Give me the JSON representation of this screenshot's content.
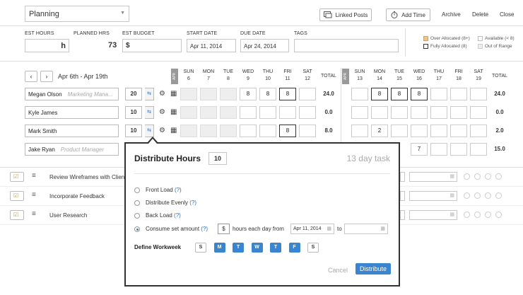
{
  "project": {
    "name": "Planning",
    "buttons": {
      "linked_posts": "Linked Posts",
      "add_time": "Add Time",
      "archive": "Archive",
      "delete": "Delete",
      "close": "Close"
    }
  },
  "fields": {
    "est_hours_label": "EST HOURS",
    "est_hours_value": "h",
    "planned_hrs_label": "PLANNED HRS",
    "planned_hrs_value": "73",
    "est_budget_label": "EST BUDGET",
    "est_budget_value": "$",
    "start_date_label": "START DATE",
    "start_date_value": "Apr 11, 2014",
    "due_date_label": "DUE DATE",
    "due_date_value": "Apr 24, 2014",
    "tags_label": "TAGS",
    "tags_value": ""
  },
  "legend": {
    "over": "Over Allocated (8+)",
    "available": "Available (< 8)",
    "fully": "Fully Allocated (8)",
    "out_of_range": "Out of Range",
    "colors": {
      "over": "#f5c37a",
      "fully": "#ffffff",
      "available": "#ffffff",
      "out_of_range": "#eeeeee"
    }
  },
  "calendar": {
    "range": "Apr 6th - Apr 19th",
    "month_tag": "APR",
    "total_label": "TOTAL",
    "week1": [
      {
        "day": "SUNDAY",
        "abbr": "SUN",
        "date": "6"
      },
      {
        "day": "MONDAY",
        "abbr": "MON",
        "date": "7"
      },
      {
        "day": "TUESDAY",
        "abbr": "TUE",
        "date": "8"
      },
      {
        "day": "WEDNESDAY",
        "abbr": "WED",
        "date": "9"
      },
      {
        "day": "THURSDAY",
        "abbr": "THU",
        "date": "10"
      },
      {
        "day": "FRIDAY",
        "abbr": "FRI",
        "date": "11"
      },
      {
        "day": "SATURDAY",
        "abbr": "SAT",
        "date": "12"
      }
    ],
    "week2": [
      {
        "abbr": "SUN",
        "date": "13"
      },
      {
        "abbr": "MON",
        "date": "14"
      },
      {
        "abbr": "TUE",
        "date": "15"
      },
      {
        "abbr": "WED",
        "date": "16"
      },
      {
        "abbr": "THU",
        "date": "17"
      },
      {
        "abbr": "FRI",
        "date": "18"
      },
      {
        "abbr": "SAT",
        "date": "19"
      }
    ]
  },
  "people": [
    {
      "name": "Megan Olson",
      "role": "Marketing Mana...",
      "hours": "20",
      "w1": [
        "",
        "",
        "",
        "8",
        "8",
        "8",
        ""
      ],
      "t1": "24.0",
      "w2": [
        "",
        "8",
        "8",
        "8",
        "",
        "",
        ""
      ],
      "t2": "24.0"
    },
    {
      "name": "Kyle James",
      "role": "",
      "hours": "10",
      "w1": [
        "",
        "",
        "",
        "",
        "",
        "",
        ""
      ],
      "t1": "0.0",
      "w2": [
        "",
        "",
        "",
        "",
        "",
        "",
        ""
      ],
      "t2": "0.0"
    },
    {
      "name": "Mark Smith",
      "role": "",
      "hours": "10",
      "w1": [
        "",
        "",
        "",
        "",
        "",
        "8",
        ""
      ],
      "t1": "8.0",
      "w2": [
        "",
        "2",
        "",
        "",
        "",
        "",
        ""
      ],
      "t2": "2.0"
    },
    {
      "name": "Jake Ryan",
      "role": "Product Manager",
      "hours": "",
      "w1": [],
      "t1": "",
      "w2": [
        "",
        "",
        "",
        "7",
        "",
        "",
        ""
      ],
      "t2": "15.0"
    }
  ],
  "tasks": [
    {
      "name": "Review Wireframes with Client"
    },
    {
      "name": "Incorporate Feedback"
    },
    {
      "name": "User Research"
    }
  ],
  "modal": {
    "title": "Distribute Hours",
    "hours": "10",
    "task_length": "13 day task",
    "options": [
      {
        "label": "Front Load",
        "help": "(?)"
      },
      {
        "label": "Distribute Evenly",
        "help": "(?)"
      },
      {
        "label": "Back Load",
        "help": "(?)"
      },
      {
        "label": "Consume set amount",
        "help": "(?)"
      }
    ],
    "amount_value": "$",
    "each_day_text": "hours each day from",
    "from_date": "Apr 11, 2014",
    "to_text": "to",
    "to_date": "",
    "workweek_label": "Define Workweek",
    "days": [
      {
        "letter": "S",
        "active": false
      },
      {
        "letter": "M",
        "active": true
      },
      {
        "letter": "T",
        "active": true
      },
      {
        "letter": "W",
        "active": true
      },
      {
        "letter": "T",
        "active": true
      },
      {
        "letter": "F",
        "active": true
      },
      {
        "letter": "S",
        "active": false
      }
    ],
    "cancel": "Cancel",
    "distribute": "Distribute"
  }
}
